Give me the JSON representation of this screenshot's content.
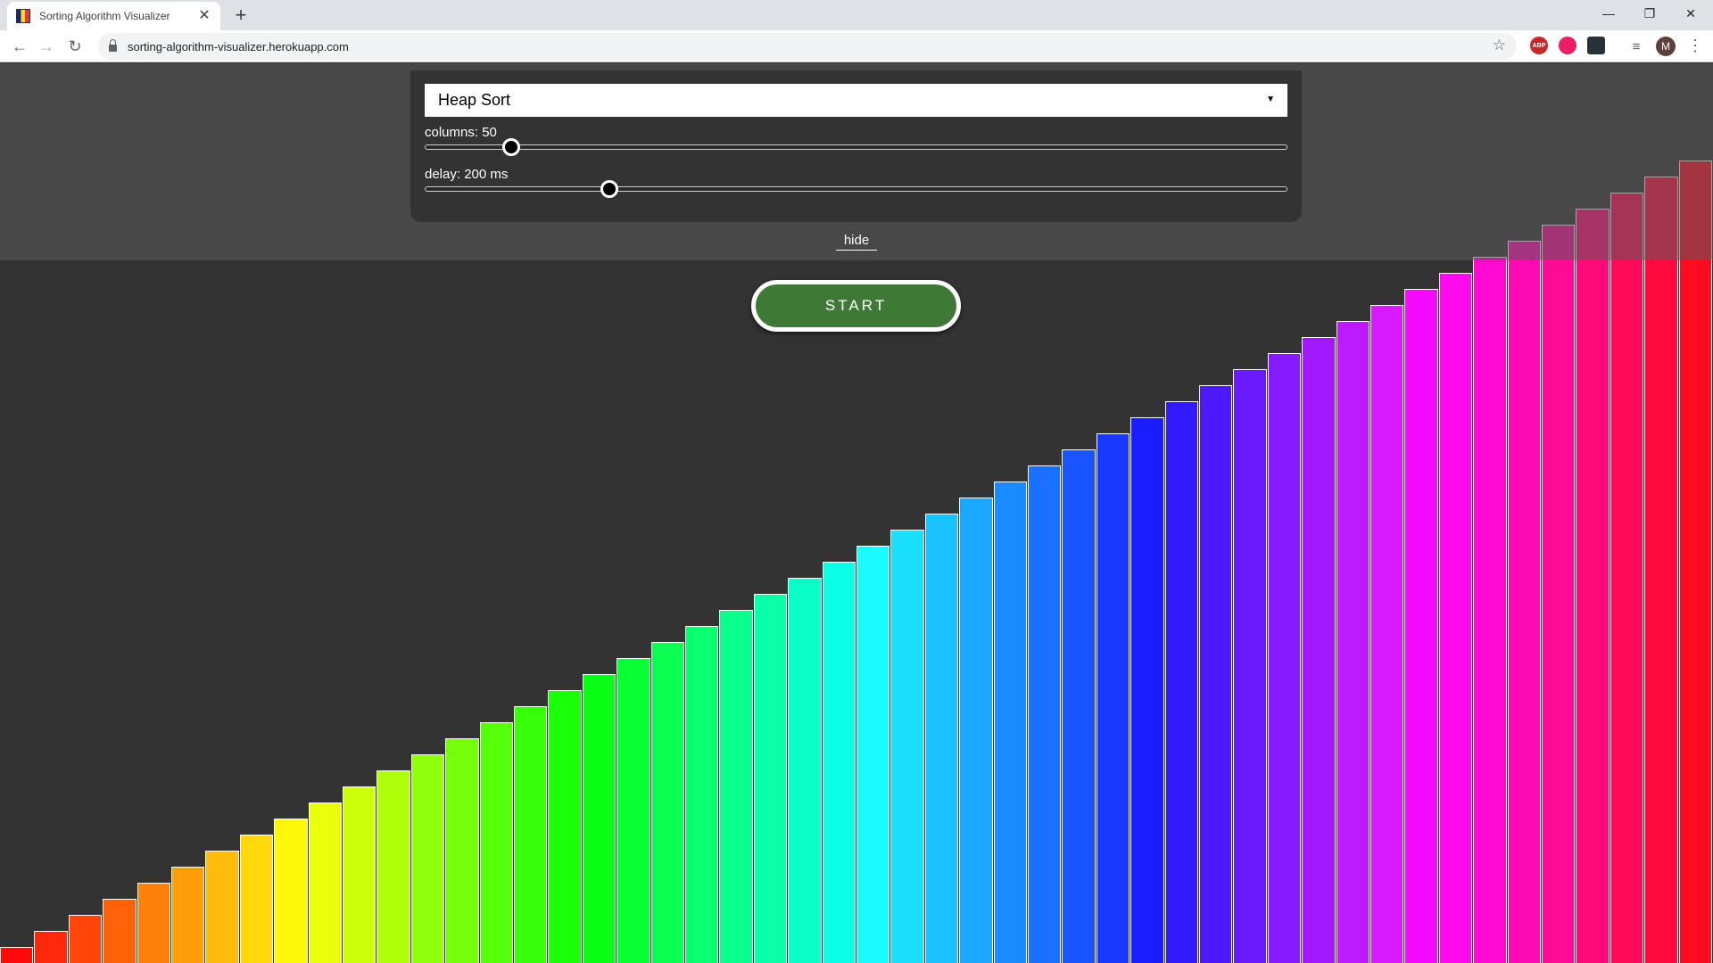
{
  "browser": {
    "tab_title": "Sorting Algorithm Visualizer",
    "url": "sorting-algorithm-visualizer.herokuapp.com",
    "profile_initial": "M",
    "extensions": [
      {
        "name": "adblock-plus-icon",
        "label": "ABP",
        "color": "#c62828"
      },
      {
        "name": "extension-icon",
        "label": "",
        "color": "#e91e63"
      },
      {
        "name": "react-devtools-icon",
        "label": "",
        "color": "#263238"
      }
    ]
  },
  "controls": {
    "algorithm": "Heap Sort",
    "columns_label": "columns: 50",
    "columns_value": 50,
    "columns_fraction": 0.091,
    "delay_label": "delay: 200 ms",
    "delay_value": 200,
    "delay_fraction": 0.207,
    "hide_label": "hide",
    "start_label": "START"
  },
  "visualization": {
    "column_count": 50,
    "values": [
      1,
      2,
      3,
      4,
      5,
      6,
      7,
      8,
      9,
      10,
      11,
      12,
      13,
      14,
      15,
      16,
      17,
      18,
      19,
      20,
      21,
      22,
      23,
      24,
      25,
      26,
      27,
      28,
      29,
      30,
      31,
      32,
      33,
      34,
      35,
      36,
      37,
      38,
      39,
      40,
      41,
      42,
      43,
      44,
      45,
      46,
      47,
      48,
      49,
      50
    ],
    "max_value": 50,
    "hue_start": 0,
    "hue_end": 355
  }
}
